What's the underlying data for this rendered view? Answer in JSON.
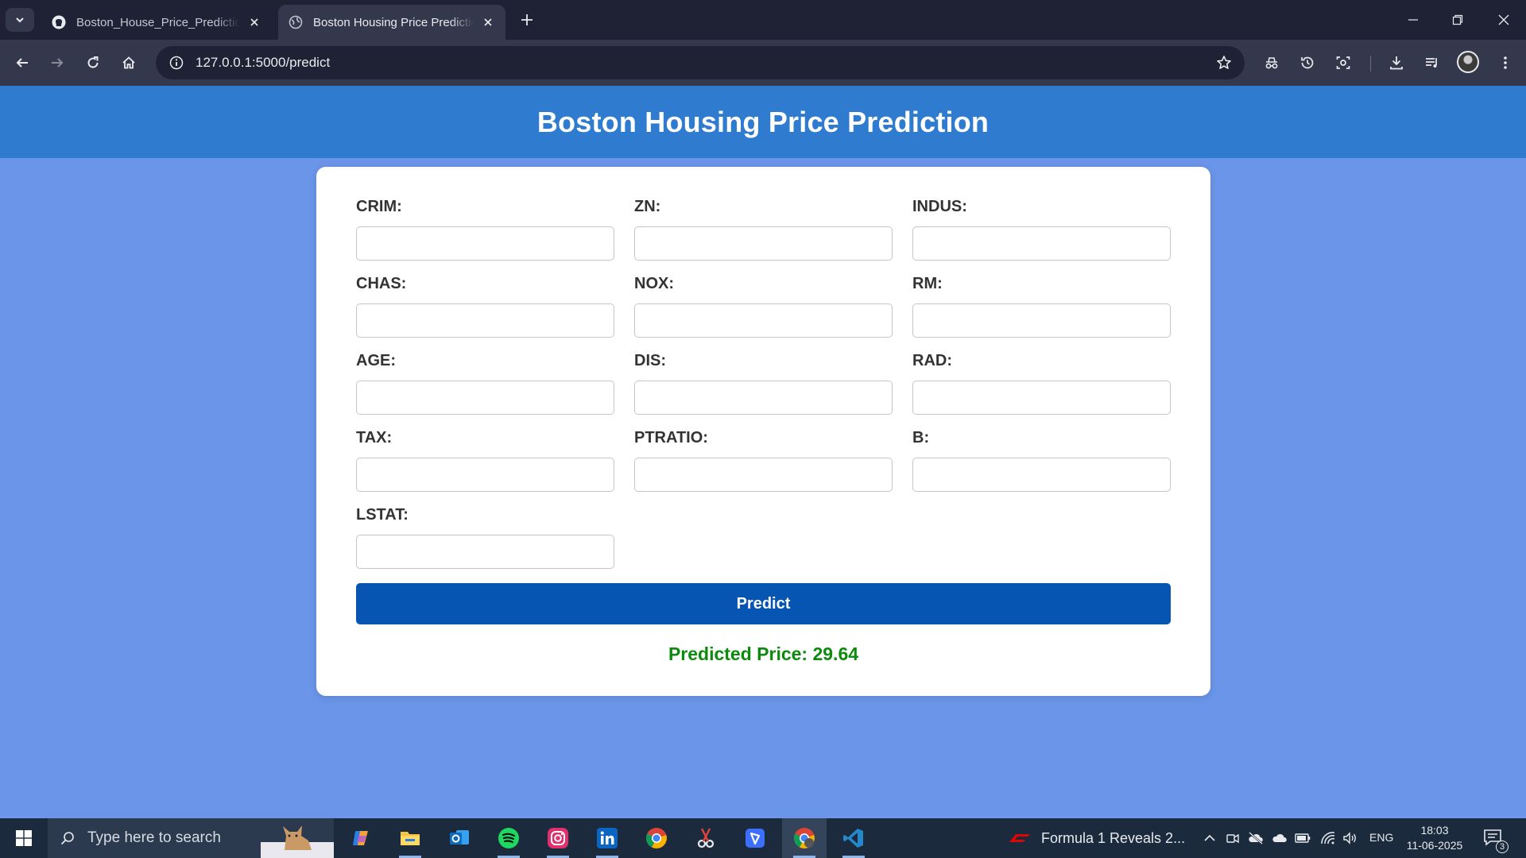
{
  "browser": {
    "tabs": [
      {
        "title": "Boston_House_Price_Prediction",
        "favicon": "github-icon",
        "active": false
      },
      {
        "title": "Boston Housing Price Prediction",
        "favicon": "globe-icon",
        "active": true
      }
    ],
    "url": "127.0.0.1:5000/predict"
  },
  "page": {
    "title": "Boston Housing Price Prediction",
    "fields": [
      {
        "label": "CRIM:",
        "value": ""
      },
      {
        "label": "ZN:",
        "value": ""
      },
      {
        "label": "INDUS:",
        "value": ""
      },
      {
        "label": "CHAS:",
        "value": ""
      },
      {
        "label": "NOX:",
        "value": ""
      },
      {
        "label": "RM:",
        "value": ""
      },
      {
        "label": "AGE:",
        "value": ""
      },
      {
        "label": "DIS:",
        "value": ""
      },
      {
        "label": "RAD:",
        "value": ""
      },
      {
        "label": "TAX:",
        "value": ""
      },
      {
        "label": "PTRATIO:",
        "value": ""
      },
      {
        "label": "B:",
        "value": ""
      },
      {
        "label": "LSTAT:",
        "value": ""
      }
    ],
    "predict_label": "Predict",
    "result": "Predicted Price: 29.64"
  },
  "taskbar": {
    "search_placeholder": "Type here to search",
    "news": "Formula 1 Reveals 2...",
    "language": "ENG",
    "time": "18:03",
    "date": "11-06-2025",
    "notification_count": "3"
  },
  "colors": {
    "header": "#2e7bd0",
    "background": "#6b95e8",
    "button": "#0755b3",
    "result": "#0c8a0c"
  }
}
